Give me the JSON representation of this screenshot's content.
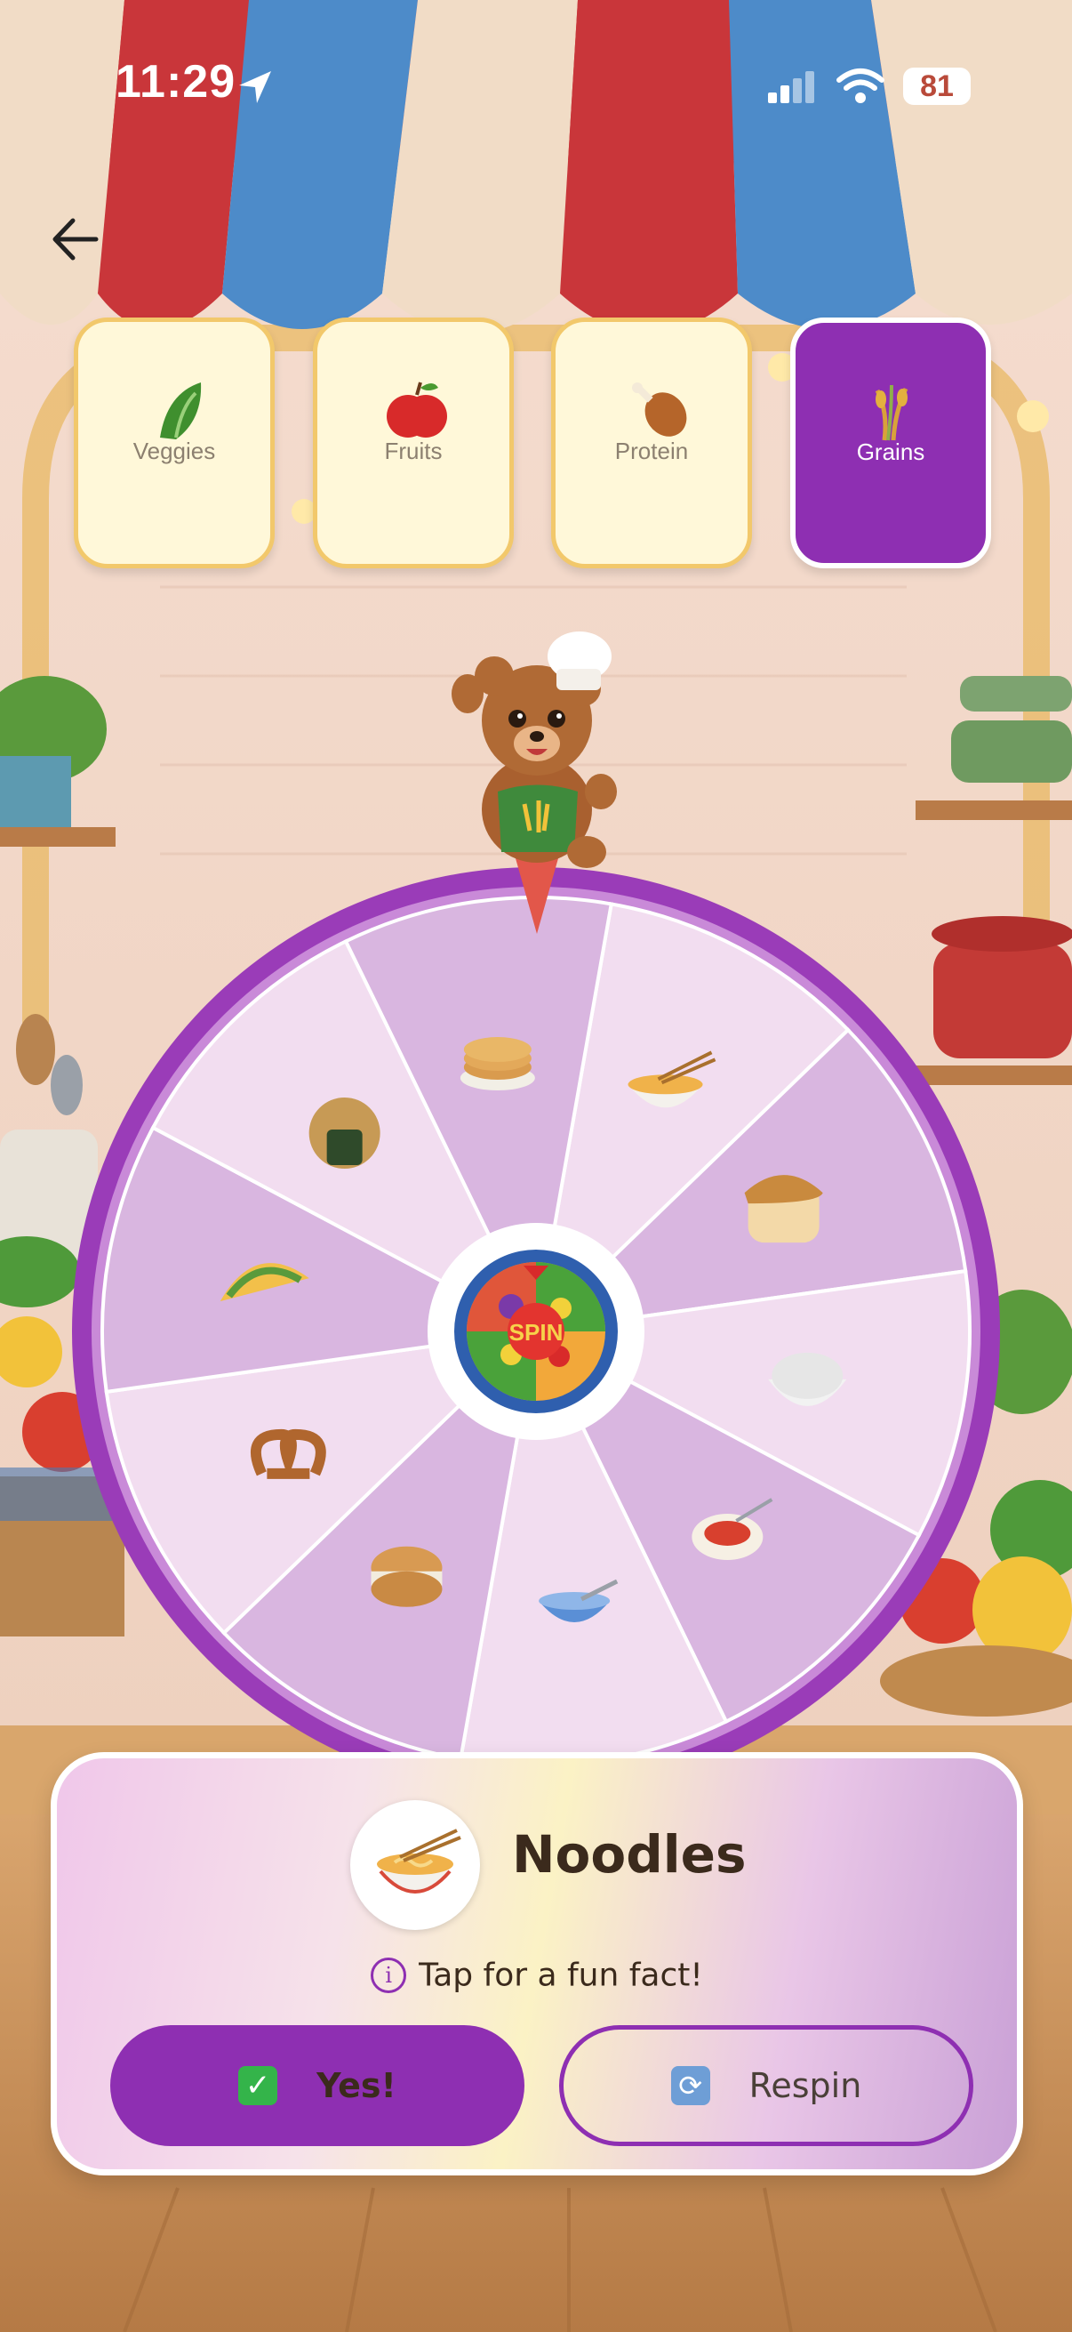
{
  "status_bar": {
    "time": "11:29",
    "battery": "81"
  },
  "categories": [
    {
      "label": "Veggies",
      "icon": "leafy-greens-icon"
    },
    {
      "label": "Fruits",
      "icon": "red-apple-icon"
    },
    {
      "label": "Protein",
      "icon": "drumstick-icon"
    },
    {
      "label": "Grains",
      "icon": "rice-sheaf-icon",
      "selected": true
    }
  ],
  "wheel": {
    "center_label": "SPIN",
    "segments": [
      "noodles-icon",
      "bread-icon",
      "rice-bowl-icon",
      "spaghetti-icon",
      "porridge-bowl-icon",
      "bagel-icon",
      "pretzel-icon",
      "taco-icon",
      "rice-ball-icon",
      "pancakes-icon"
    ]
  },
  "result": {
    "food_name": "Noodles",
    "fun_fact_prompt": "Tap for a fun fact!",
    "yes_label": "Yes!",
    "respin_label": "Respin"
  },
  "colors": {
    "accent": "#8E2FB2",
    "tile_bg": "#FFF8D9",
    "tile_border": "#F2C86B",
    "segment_light": "#F2DDF0",
    "segment_dark": "#D9B6E0"
  }
}
